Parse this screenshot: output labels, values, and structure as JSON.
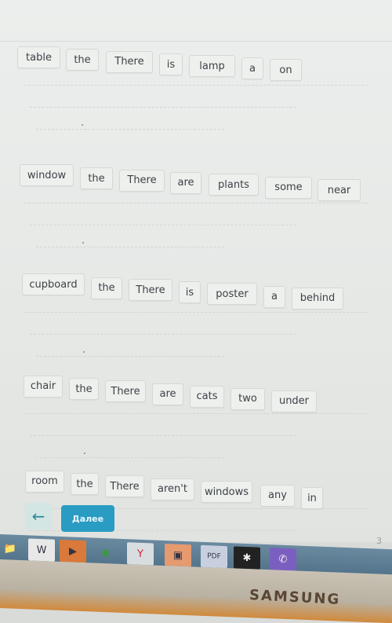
{
  "exercises": [
    {
      "words": [
        "table",
        "the",
        "There",
        "is",
        "lamp",
        "a",
        "on"
      ]
    },
    {
      "words": [
        "window",
        "the",
        "There",
        "are",
        "plants",
        "some",
        "near"
      ]
    },
    {
      "words": [
        "cupboard",
        "the",
        "There",
        "is",
        "poster",
        "a",
        "behind"
      ]
    },
    {
      "words": [
        "chair",
        "the",
        "There",
        "are",
        "cats",
        "two",
        "under"
      ]
    },
    {
      "words": [
        "room",
        "the",
        "There",
        "aren't",
        "windows",
        "any",
        "in"
      ]
    }
  ],
  "nav": {
    "back_icon": "←",
    "next_label": "Далее"
  },
  "taskbar": {
    "icons": [
      "folder-icon",
      "word-icon",
      "media-player-icon",
      "chrome-icon",
      "yandex-browser-icon",
      "photo-viewer-icon",
      "pdf-icon",
      "fan-app-icon",
      "viber-icon"
    ],
    "clock_partial": "3"
  },
  "bezel": {
    "brand": "SAMSUNG"
  },
  "colors": {
    "accent": "#2a9cc3",
    "back_bg": "#d3e6e4"
  }
}
